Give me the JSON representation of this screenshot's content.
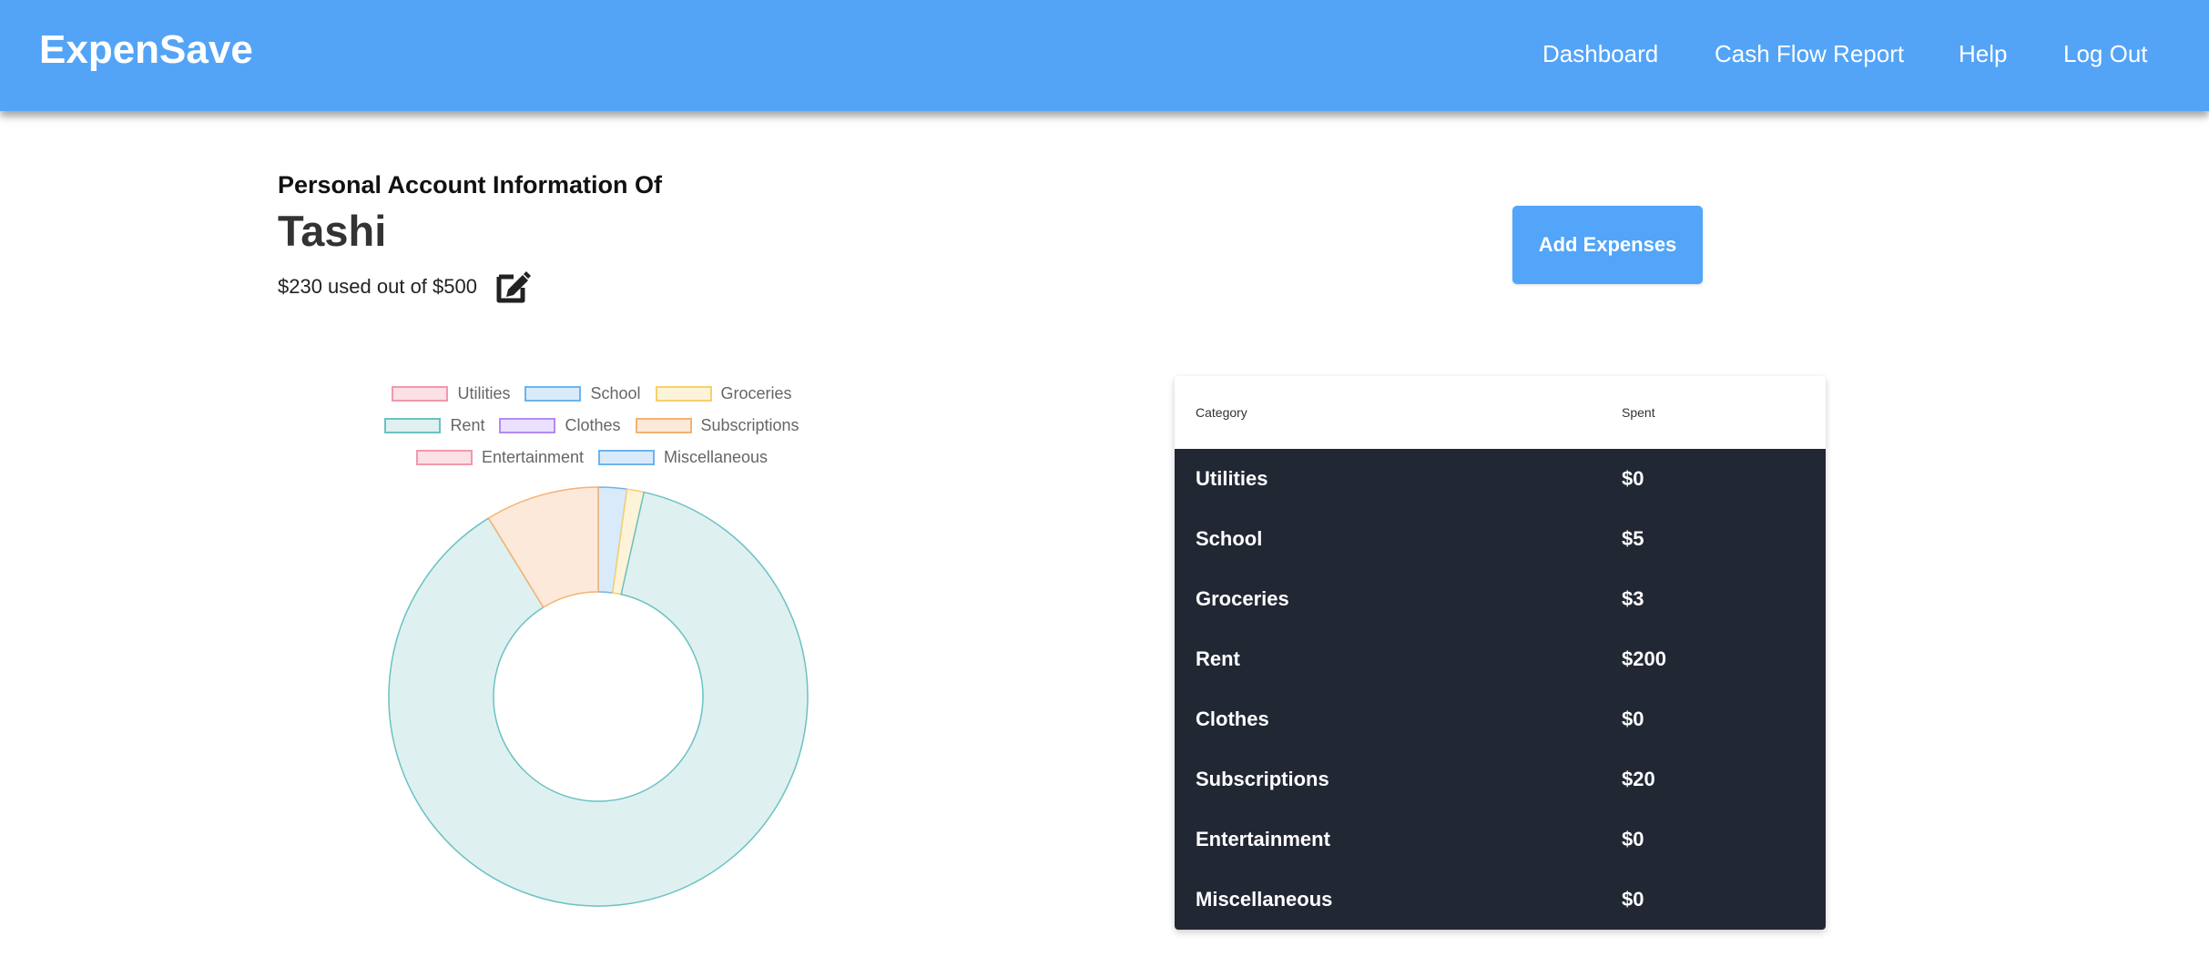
{
  "nav": {
    "brand": "ExpenSave",
    "links": [
      "Dashboard",
      "Cash Flow Report",
      "Help",
      "Log Out"
    ]
  },
  "account": {
    "heading": "Personal Account Information Of",
    "name": "Tashi",
    "budget_text": "$230 used out of $500",
    "edit_icon": "edit-icon"
  },
  "actions": {
    "add_expenses_label": "Add Expenses"
  },
  "table": {
    "headers": [
      "Category",
      "Spent"
    ],
    "rows": [
      [
        "Utilities",
        "$0"
      ],
      [
        "School",
        "$5"
      ],
      [
        "Groceries",
        "$3"
      ],
      [
        "Rent",
        "$200"
      ],
      [
        "Clothes",
        "$0"
      ],
      [
        "Subscriptions",
        "$20"
      ],
      [
        "Entertainment",
        "$0"
      ],
      [
        "Miscellaneous",
        "$0"
      ]
    ]
  },
  "chart_data": {
    "type": "pie",
    "categories": [
      "Utilities",
      "School",
      "Groceries",
      "Rent",
      "Clothes",
      "Subscriptions",
      "Entertainment",
      "Miscellaneous"
    ],
    "values": [
      0,
      5,
      3,
      200,
      0,
      20,
      0,
      0
    ],
    "legend_position": "top",
    "colors": {
      "fill": [
        "#fbe0e5",
        "#d9ebfb",
        "#fdf3d9",
        "#dff0f0",
        "#ebe0fd",
        "#fde9d9",
        "#fbe0e5",
        "#d9ebfb"
      ],
      "stroke": [
        "#f09aaa",
        "#6fb3ec",
        "#f7cf6b",
        "#6cc1c1",
        "#b48af2",
        "#f4b273",
        "#f09aaa",
        "#6fb3ec"
      ]
    }
  }
}
